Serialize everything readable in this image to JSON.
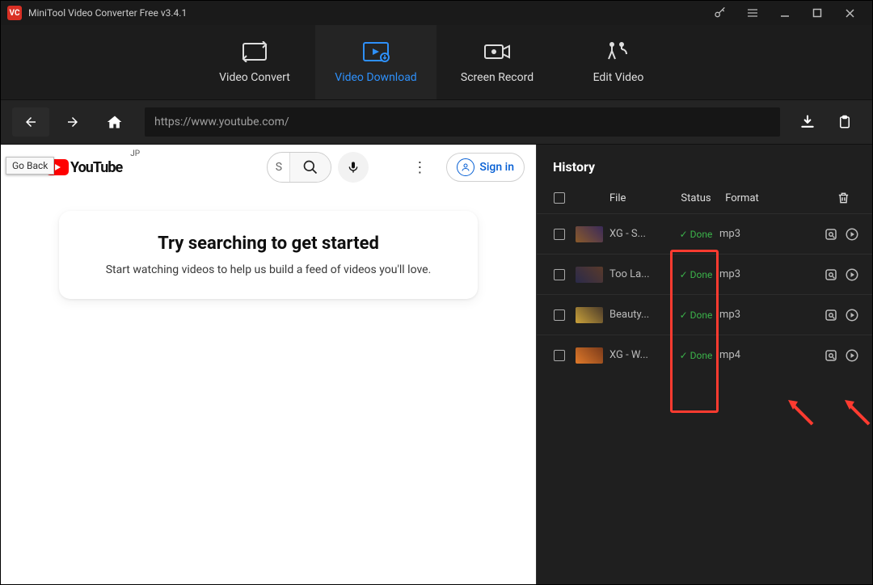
{
  "titlebar": {
    "title": "MiniTool Video Converter Free v3.4.1"
  },
  "tooltip": "Go Back",
  "tabs": {
    "convert": "Video Convert",
    "download": "Video Download",
    "record": "Screen Record",
    "edit": "Edit Video"
  },
  "url": "https://www.youtube.com/",
  "youtube": {
    "brand": "YouTube",
    "region": "JP",
    "search_short": "S",
    "signin": "Sign in",
    "card_title": "Try searching to get started",
    "card_sub": "Start watching videos to help us build a feed of videos you'll love."
  },
  "history": {
    "title": "History",
    "cols": {
      "file": "File",
      "status": "Status",
      "format": "Format"
    },
    "rows": [
      {
        "file": "XG - S...",
        "status": "✓ Done",
        "format": "mp3"
      },
      {
        "file": "Too La...",
        "status": "✓ Done",
        "format": "mp3"
      },
      {
        "file": "Beauty...",
        "status": "✓ Done",
        "format": "mp3"
      },
      {
        "file": "XG - W...",
        "status": "✓ Done",
        "format": "mp4"
      }
    ]
  }
}
